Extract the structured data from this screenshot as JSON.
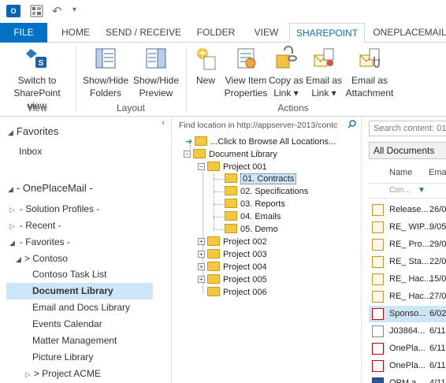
{
  "qat": {
    "outlook_icon": "outlook-icon",
    "undo_icon": "undo-icon"
  },
  "tabs": [
    {
      "label": "FILE"
    },
    {
      "label": "HOME"
    },
    {
      "label": "SEND / RECEIVE"
    },
    {
      "label": "FOLDER"
    },
    {
      "label": "VIEW"
    },
    {
      "label": "SHAREPOINT"
    },
    {
      "label": "ONEPLACEMAIL"
    }
  ],
  "ribbon": {
    "view": {
      "switch_line1": "Switch to",
      "switch_line2": "SharePoint view",
      "group": "View"
    },
    "layout": {
      "showhide_folders_line1": "Show/Hide",
      "showhide_folders_line2": "Folders",
      "showhide_preview_line1": "Show/Hide",
      "showhide_preview_line2": "Preview",
      "group": "Layout"
    },
    "actions": {
      "new": "New",
      "view_item_line1": "View Item",
      "view_item_line2": "Properties",
      "copy_line1": "Copy as",
      "copy_line2": "Link ▾",
      "email_link_line1": "Email as",
      "email_link_line2": "Link ▾",
      "email_attach_line1": "Email as",
      "email_attach_line2": "Attachment",
      "group": "Actions"
    }
  },
  "nav": {
    "favorites": "Favorites",
    "inbox": "Inbox",
    "oneplacemail": "- OnePlaceMail -",
    "solution_profiles": "- Solution Profiles -",
    "recent": "- Recent -",
    "favorites2": "- Favorites -",
    "contoso": "> Contoso",
    "items": [
      "Contoso Task List",
      "Document Library",
      "Email and Docs Library",
      "Events Calendar",
      "Matter Management",
      "Picture Library"
    ],
    "project_acme": "> Project ACME"
  },
  "tree": {
    "search_placeholder": "Find location in http://appserver-2013/contc",
    "browse_all": "...Click to Browse All Locations...",
    "document_library": "Document Library",
    "project001": "Project 001",
    "children": [
      "01. Contracts",
      "02. Specifications",
      "03. Reports",
      "04. Emails",
      "05. Demo"
    ],
    "projects": [
      "Project 002",
      "Project 003",
      "Project 004",
      "Project 005",
      "Project 006"
    ]
  },
  "content": {
    "search_placeholder": "Search content: 01",
    "view_selected": "All Documents",
    "col_name": "Name",
    "col_email": "Ema",
    "filter_placeholder": "Con...",
    "rows": [
      {
        "name": "Release...",
        "email": "26/0",
        "icon": "envelope-icon"
      },
      {
        "name": "RE_ WIP...",
        "email": "9/05",
        "icon": "envelope-icon"
      },
      {
        "name": "RE_ Pro...",
        "email": "29/0",
        "icon": "envelope-icon"
      },
      {
        "name": "RE_ Sta...",
        "email": "22/0",
        "icon": "envelope-icon"
      },
      {
        "name": "RE_ Hac...",
        "email": "15/0",
        "icon": "envelope-icon"
      },
      {
        "name": "RE_ Hac...",
        "email": "27/0",
        "icon": "envelope-icon"
      },
      {
        "name": "Sponso...",
        "email": "6/02",
        "icon": "pdf-icon"
      },
      {
        "name": "J03864...",
        "email": "6/11",
        "icon": "document-icon"
      },
      {
        "name": "OnePla...",
        "email": "6/11",
        "icon": "pdf-icon"
      },
      {
        "name": "OnePla...",
        "email": "6/11",
        "icon": "pdf-icon"
      },
      {
        "name": "OPM a...",
        "email": "4/11",
        "icon": "word-icon"
      }
    ]
  }
}
